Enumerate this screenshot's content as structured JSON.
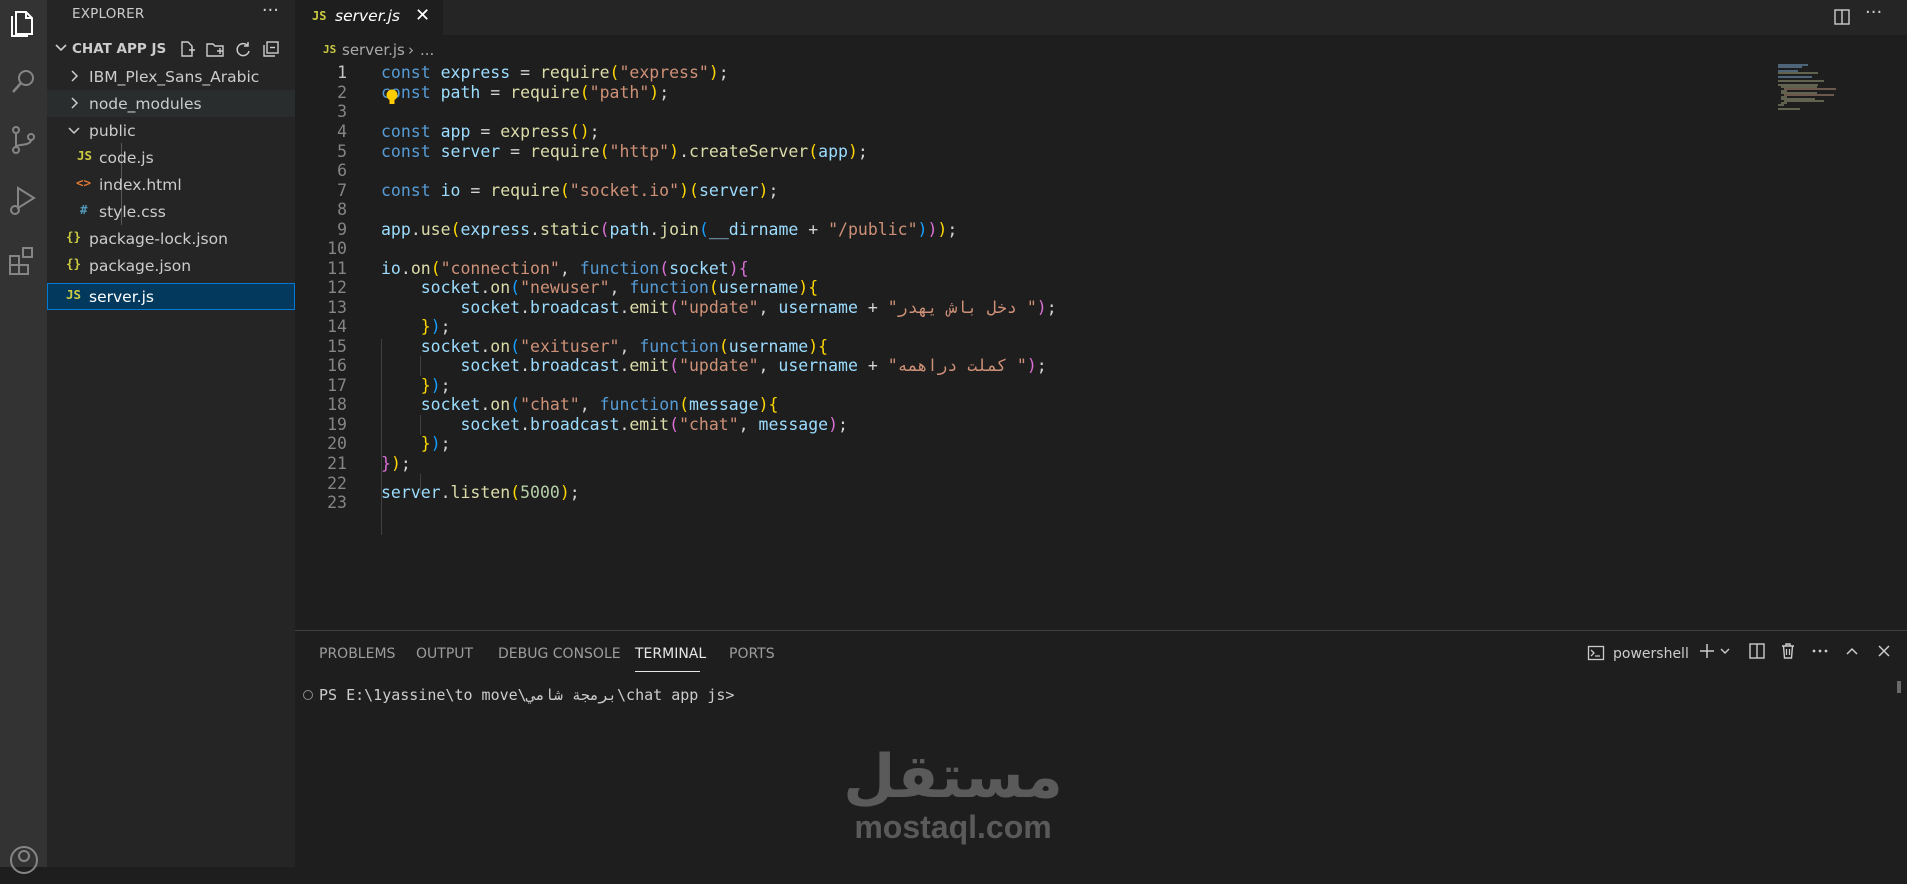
{
  "sidebar": {
    "title": "EXPLORER",
    "more": "···",
    "project": "CHAT APP JS",
    "tree": [
      {
        "label": "IBM_Plex_Sans_Arabic",
        "kind": "folder",
        "expanded": false
      },
      {
        "label": "node_modules",
        "kind": "folder",
        "expanded": false
      },
      {
        "label": "public",
        "kind": "folder",
        "expanded": true
      },
      {
        "label": "code.js",
        "kind": "js",
        "icon": "JS"
      },
      {
        "label": "index.html",
        "kind": "html",
        "icon": "<>"
      },
      {
        "label": "style.css",
        "kind": "css",
        "icon": "#"
      },
      {
        "label": "package-lock.json",
        "kind": "json",
        "icon": "{}"
      },
      {
        "label": "package.json",
        "kind": "json",
        "icon": "{}"
      },
      {
        "label": "server.js",
        "kind": "js",
        "icon": "JS",
        "selected": true
      }
    ]
  },
  "tab": {
    "icon": "JS",
    "label": "server.js",
    "close": "✕"
  },
  "breadcrumb": {
    "icon": "JS",
    "file": "server.js",
    "sep": "›",
    "more": "..."
  },
  "editor": {
    "line_numbers": [
      "1",
      "2",
      "3",
      "4",
      "5",
      "6",
      "7",
      "8",
      "9",
      "10",
      "11",
      "12",
      "13",
      "14",
      "15",
      "16",
      "17",
      "18",
      "19",
      "20",
      "21",
      "22",
      "23"
    ],
    "arabic_1": "دخل باش يهدر ",
    "arabic_2": "كملت دراهمه "
  },
  "panel": {
    "tabs": [
      "PROBLEMS",
      "OUTPUT",
      "DEBUG CONSOLE",
      "TERMINAL",
      "PORTS"
    ],
    "active_tab": "TERMINAL",
    "shell": "powershell",
    "prompt": "PS E:\\1yassine\\to move\\برمجة شامي\\chat app js>"
  },
  "watermark": {
    "arabic": "مستقل",
    "latin": "mostaql.com"
  },
  "colors": {
    "accent": "#0078d4",
    "js": "#cbcb41",
    "html": "#e37933",
    "css": "#519aba"
  }
}
